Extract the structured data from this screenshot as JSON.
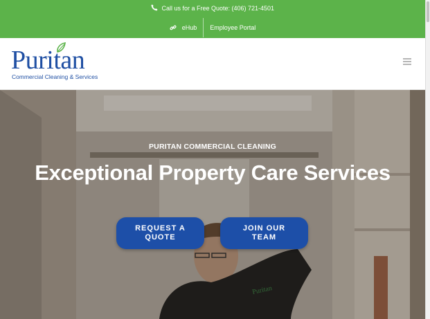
{
  "topbar": {
    "call_text": "Call us for a Free Quote: (406) 721-4501",
    "links": [
      {
        "label": "eHub",
        "icon": "link-icon"
      },
      {
        "label": "Employee Portal"
      }
    ],
    "color": "#5cb34a"
  },
  "header": {
    "logo_word": "Puritan",
    "logo_sub": "Commercial Cleaning & Services",
    "logo_color": "#1f4fa3",
    "menu_icon": "hamburger-menu-icon"
  },
  "hero": {
    "eyebrow": "PURITAN COMMERCIAL CLEANING",
    "headline": "Exceptional Property Care Services",
    "buttons": [
      {
        "label_line1": "REQUEST A",
        "label_line2": "QUOTE"
      },
      {
        "label_line1": "JOIN OUR",
        "label_line2": "TEAM"
      }
    ],
    "button_color": "#1d4fa8",
    "shirt_logo": "Puritan"
  }
}
